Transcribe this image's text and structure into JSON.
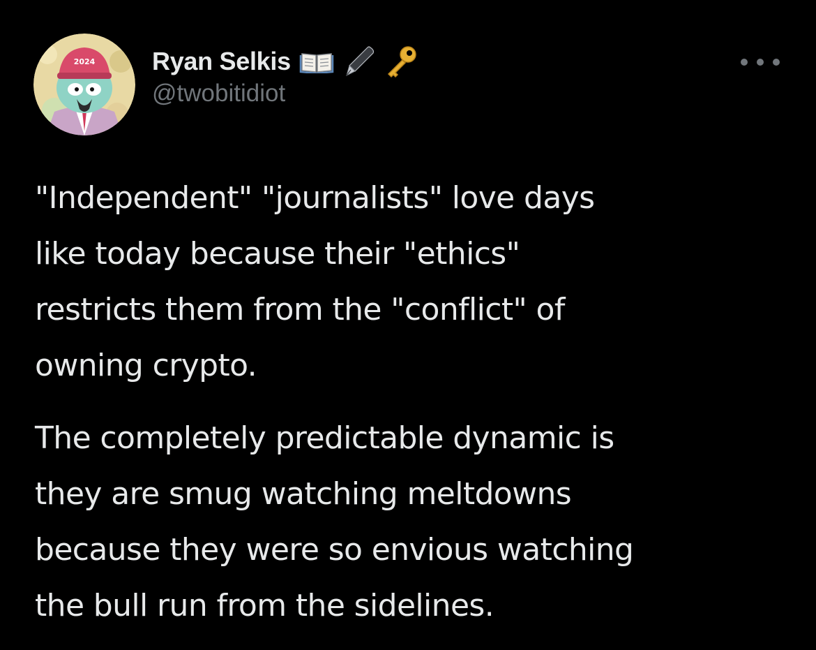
{
  "author": {
    "display_name": "Ryan Selkis",
    "handle": "@twobitidiot",
    "name_emojis": [
      "open-book-emoji",
      "black-nib-emoji",
      "key-emoji"
    ],
    "avatar_text": "2024"
  },
  "menu": {
    "icon": "more-horizontal-icon"
  },
  "tweet": {
    "paragraphs": [
      "\"Independent\" \"journalists\" love days\nlike today because their \"ethics\"\nrestricts them from the \"conflict\" of\nowning crypto.",
      "The completely predictable dynamic is\nthey are smug watching meltdowns\nbecause they were so envious watching\nthe bull run from the sidelines."
    ]
  },
  "colors": {
    "background": "#000000",
    "primary_text": "#e7e9ea",
    "secondary_text": "#71767b"
  }
}
